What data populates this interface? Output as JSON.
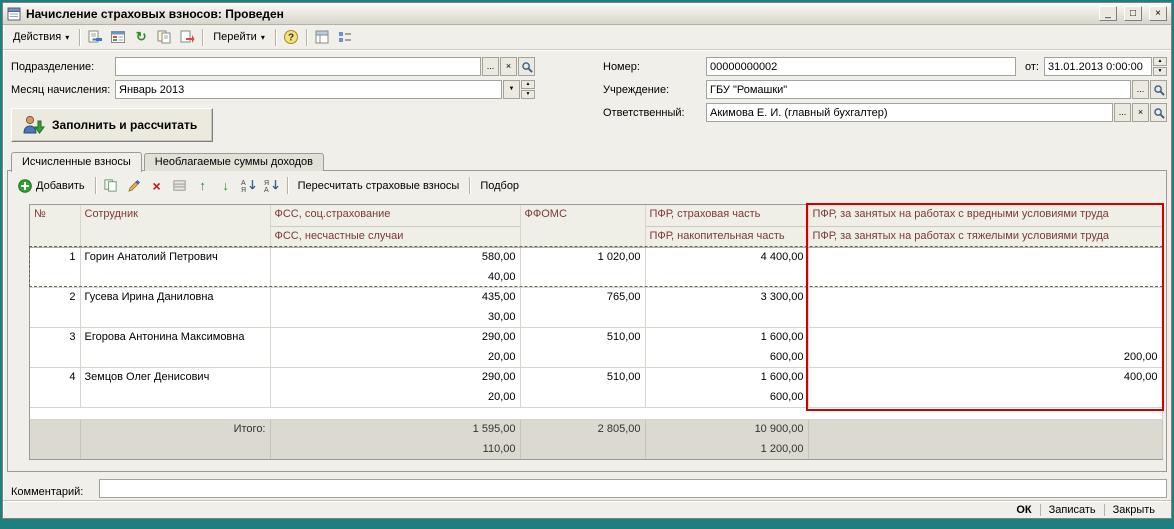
{
  "colors": {
    "desktop": "#1e7f7f",
    "window_bg": "#f0efe9",
    "header_text": "#7b3b33",
    "highlight_red": "#d40000",
    "totals_bg": "#dcd9d1"
  },
  "window": {
    "title": "Начисление страховых взносов: Проведен",
    "minimize": "_",
    "maximize": "□",
    "close": "×"
  },
  "icons": {
    "dropdown": "▾",
    "combo_arrow": "▼",
    "spin_up": "▲",
    "spin_down": "▼",
    "ellipsis": "...",
    "clear": "×",
    "refresh": "↻",
    "move_up": "↑",
    "move_down": "↓",
    "delete": "×",
    "help": "?"
  },
  "toolbar": {
    "actions": "Действия",
    "goto": "Перейти"
  },
  "form": {
    "department": {
      "label": "Подразделение:",
      "value": ""
    },
    "month": {
      "label": "Месяц начисления:",
      "value": "Январь 2013"
    },
    "number": {
      "label": "Номер:",
      "value": "00000000002"
    },
    "date": {
      "label": "от:",
      "value": "31.01.2013 0:00:00"
    },
    "institution": {
      "label": "Учреждение:",
      "value": "ГБУ \"Ромашки\""
    },
    "responsible": {
      "label": "Ответственный:",
      "value": "Акимова Е. И. (главный бухгалтер)"
    },
    "fill_button": "Заполнить и рассчитать"
  },
  "tabs": [
    {
      "label": "Исчисленные взносы"
    },
    {
      "label": "Необлагаемые суммы доходов"
    }
  ],
  "table_toolbar": {
    "add": "Добавить",
    "recalculate": "Пересчитать страховые взносы",
    "pick": "Подбор"
  },
  "table": {
    "columns": {
      "num": "№",
      "employee": "Сотрудник",
      "fss_social": "ФСС, соц.страхование",
      "fss_accidents": "ФСС, несчастные случаи",
      "ffoms": "ФФОМС",
      "pfr_insurance": "ПФР, страховая часть",
      "pfr_funded": "ПФР, накопительная часть",
      "pfr_harmful": "ПФР, за занятых на работах с вредными условиями труда",
      "pfr_heavy": "ПФР, за занятых на работах с тяжелыми условиями труда"
    },
    "rows": [
      {
        "num": "1",
        "employee": "Горин Анатолий Петрович",
        "fss1": "580,00",
        "fss2": "40,00",
        "ffoms": "1 020,00",
        "pfr1": "4 400,00",
        "pfr2": "",
        "harm1": "",
        "harm2": ""
      },
      {
        "num": "2",
        "employee": "Гусева Ирина Даниловна",
        "fss1": "435,00",
        "fss2": "30,00",
        "ffoms": "765,00",
        "pfr1": "3 300,00",
        "pfr2": "",
        "harm1": "",
        "harm2": ""
      },
      {
        "num": "3",
        "employee": "Егорова Антонина Максимовна",
        "fss1": "290,00",
        "fss2": "20,00",
        "ffoms": "510,00",
        "pfr1": "1 600,00",
        "pfr2": "600,00",
        "harm1": "",
        "harm2": "200,00"
      },
      {
        "num": "4",
        "employee": "Земцов Олег Денисович",
        "fss1": "290,00",
        "fss2": "20,00",
        "ffoms": "510,00",
        "pfr1": "1 600,00",
        "pfr2": "600,00",
        "harm1": "400,00",
        "harm2": ""
      }
    ],
    "totals": {
      "label": "Итого:",
      "fss1": "1 595,00",
      "fss2": "110,00",
      "ffoms": "2 805,00",
      "pfr1": "10 900,00",
      "pfr2": "1 200,00",
      "harm1": "",
      "harm2": ""
    }
  },
  "comment": {
    "label": "Комментарий:",
    "value": ""
  },
  "statusbar": {
    "ok": "ОК",
    "save": "Записать",
    "close": "Закрыть"
  }
}
